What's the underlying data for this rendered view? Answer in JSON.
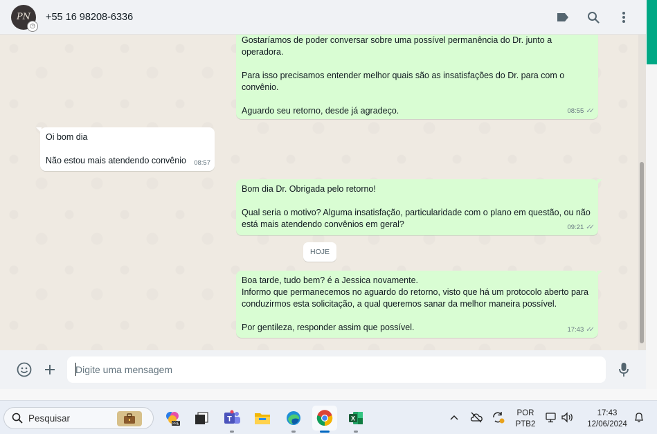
{
  "header": {
    "avatar_monogram": "PN",
    "contact": "+55 16 98208-6336",
    "icons": [
      "label-icon",
      "search-icon",
      "more-menu-icon"
    ]
  },
  "messages": [
    {
      "direction": "outgoing",
      "paragraphs": [
        "Gostaríamos de poder conversar sobre uma possível permanência do Dr. junto a operadora.",
        "Para isso precisamos entender melhor quais são as insatisfações do Dr. para com o convênio.",
        "Aguardo seu retorno, desde já agradeço."
      ],
      "time": "08:55",
      "status_icon": "double-check-icon"
    },
    {
      "direction": "incoming",
      "paragraphs": [
        "Oi bom dia",
        "Não estou mais atendendo convênio"
      ],
      "time": "08:57"
    },
    {
      "direction": "outgoing",
      "paragraphs": [
        "Bom dia Dr. Obrigada pelo retorno!",
        "Qual seria o motivo? Alguma insatisfação, particularidade com o plano em questão, ou não está mais atendendo convênios em geral?"
      ],
      "time": "09:21",
      "status_icon": "double-check-icon"
    },
    {
      "direction": "outgoing",
      "paragraphs": [
        "Boa tarde, tudo bem? é a Jessica novamente.\nInformo que permanecemos no aguardo do retorno, visto que há um protocolo aberto para conduzirmos esta solicitação, a qual queremos sanar da melhor maneira possível.",
        "Por gentileza, responder assim que possível."
      ],
      "time": "17:43",
      "status_icon": "double-check-icon"
    }
  ],
  "date_divider": "HOJE",
  "composer": {
    "placeholder": "Digite uma mensagem",
    "icons": [
      "emoji-icon",
      "attach-plus-icon",
      "microphone-icon"
    ]
  },
  "taskbar": {
    "search_placeholder": "Pesquisar",
    "apps": [
      "copilot-app-icon",
      "task-view-icon",
      "teams-icon",
      "file-explorer-icon",
      "edge-icon",
      "chrome-icon",
      "excel-icon"
    ],
    "active_app": "chrome-icon",
    "language": [
      "POR",
      "PTB2"
    ],
    "time": "17:43",
    "date": "12/06/2024"
  },
  "colors": {
    "outgoing_bubble": "#d9fdd3",
    "incoming_bubble": "#ffffff",
    "chat_background": "#efeae2",
    "accent": "#00a884"
  }
}
